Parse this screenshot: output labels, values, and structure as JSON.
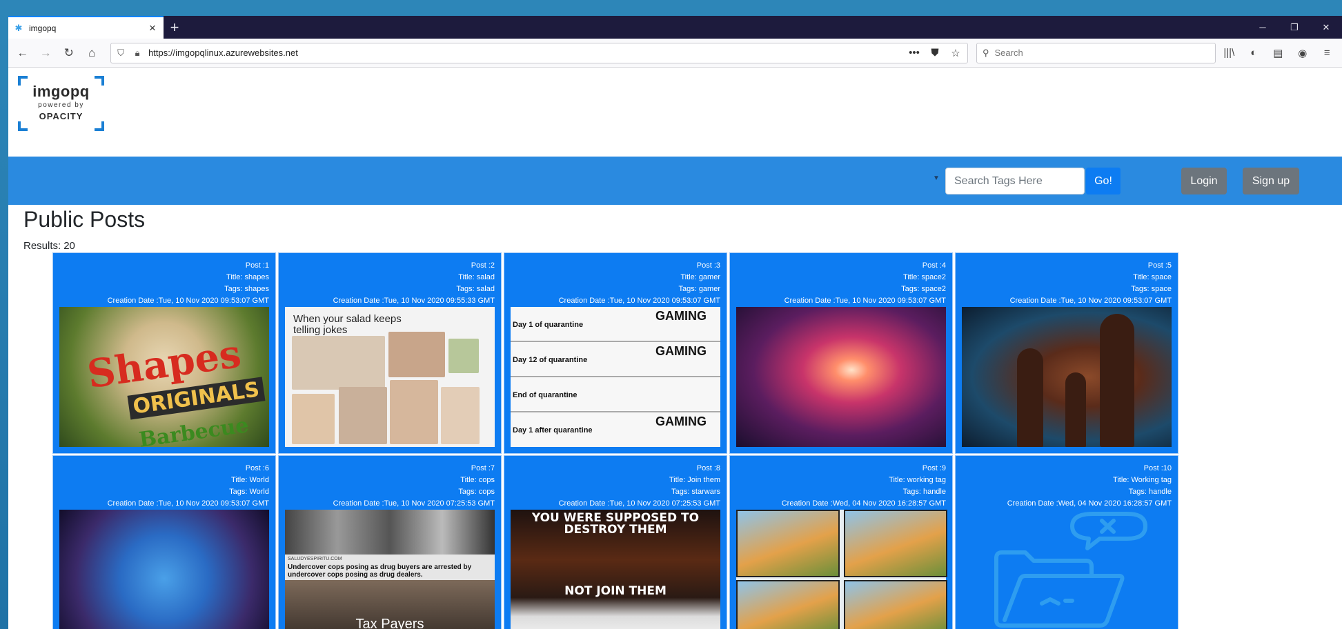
{
  "browser": {
    "tab_title": "imgopq",
    "url": "https://imgopqlinux.azurewebsites.net",
    "search_placeholder": "Search",
    "newtab_label": "+"
  },
  "site": {
    "logo_main": "imgopq",
    "logo_sub": "powered by",
    "logo_brand": "OPACITY",
    "tag_search_placeholder": "Search Tags Here",
    "go_label": "Go!",
    "login_label": "Login",
    "signup_label": "Sign up",
    "heading": "Public Posts",
    "results_label": "Results:",
    "results_count": "20"
  },
  "colors": {
    "accent_bar": "#2a8ae0",
    "card_bg": "#0d7cf2",
    "secondary_btn": "#6c757d"
  },
  "posts": [
    {
      "post": "Post :1",
      "title": "Title: shapes",
      "tags": "Tags: shapes",
      "date": "Creation Date :Tue, 10 Nov 2020 09:53:07 GMT",
      "image": "shapes-snack-photo"
    },
    {
      "post": "Post :2",
      "title": "Title: salad",
      "tags": "Tags: salad",
      "date": "Creation Date :Tue, 10 Nov 2020 09:55:33 GMT",
      "image": "salad-meme",
      "caption": "When your salad keeps telling jokes"
    },
    {
      "post": "Post :3",
      "title": "Title: gamer",
      "tags": "Tags: gamer",
      "date": "Creation Date :Tue, 10 Nov 2020 09:53:07 GMT",
      "image": "gaming-meme",
      "rows": [
        "Day 1 of quarantine",
        "Day 12 of quarantine",
        "End of quarantine",
        "Day 1 after quarantine"
      ],
      "gaming_word": "GAMING"
    },
    {
      "post": "Post :4",
      "title": "Title: space2",
      "tags": "Tags: space2",
      "date": "Creation Date :Tue, 10 Nov 2020 09:53:07 GMT",
      "image": "galaxy-photo"
    },
    {
      "post": "Post :5",
      "title": "Title: space",
      "tags": "Tags: space",
      "date": "Creation Date :Tue, 10 Nov 2020 09:53:07 GMT",
      "image": "nebula-pillars-photo"
    },
    {
      "post": "Post :6",
      "title": "Title: World",
      "tags": "Tags: World",
      "date": "Creation Date :Tue, 10 Nov 2020 09:53:07 GMT",
      "image": "world-art"
    },
    {
      "post": "Post :7",
      "title": "Title: cops",
      "tags": "Tags: cops",
      "date": "Creation Date :Tue, 10 Nov 2020 07:25:53 GMT",
      "image": "cops-meme",
      "source": "SALUDYESPIRITU.COM",
      "headline": "Undercover cops posing as drug buyers are arrested by undercover cops posing as drug dealers.",
      "bottom_text": "Tax Payers"
    },
    {
      "post": "Post :8",
      "title": "Title: Join them",
      "tags": "Tags: starwars",
      "date": "Creation Date :Tue, 10 Nov 2020 07:25:53 GMT",
      "image": "starwars-meme",
      "top_text": "YOU WERE SUPPOSED TO DESTROY THEM",
      "bottom_text": "NOT JOIN THEM"
    },
    {
      "post": "Post :9",
      "title": "Title: working tag",
      "tags": "Tags: handle",
      "date": "Creation Date :Wed, 04 Nov 2020 16:28:57 GMT",
      "image": "birds-comic"
    },
    {
      "post": "Post :10",
      "title": "Title: Working tag",
      "tags": "Tags: handle",
      "date": "Creation Date :Wed, 04 Nov 2020 16:28:57 GMT",
      "image": "missing-image-folder-icon"
    }
  ]
}
